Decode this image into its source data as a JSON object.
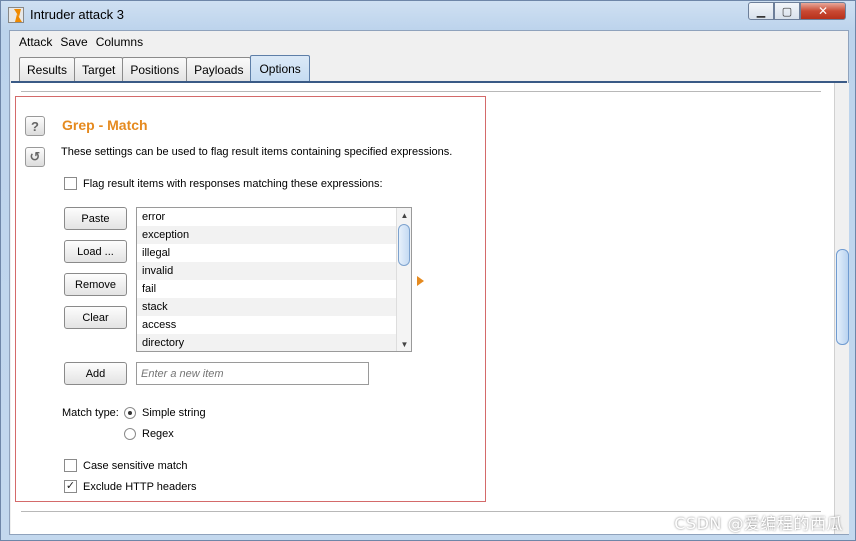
{
  "window": {
    "title": "Intruder attack 3"
  },
  "menu": [
    "Attack",
    "Save",
    "Columns"
  ],
  "tabs": [
    "Results",
    "Target",
    "Positions",
    "Payloads",
    "Options"
  ],
  "active_tab": "Options",
  "section": {
    "title": "Grep - Match",
    "description": "These settings can be used to flag result items containing specified expressions.",
    "flag_label": "Flag result items with responses matching these expressions:",
    "flag_checked": false,
    "buttons": {
      "paste": "Paste",
      "load": "Load ...",
      "remove": "Remove",
      "clear": "Clear",
      "add": "Add"
    },
    "items": [
      "error",
      "exception",
      "illegal",
      "invalid",
      "fail",
      "stack",
      "access",
      "directory"
    ],
    "new_item_placeholder": "Enter a new item",
    "match_type_label": "Match type:",
    "match_types": [
      "Simple string",
      "Regex"
    ],
    "match_type_selected": "Simple string",
    "case_sensitive_label": "Case sensitive match",
    "case_sensitive_checked": false,
    "exclude_headers_label": "Exclude HTTP headers",
    "exclude_headers_checked": true
  },
  "watermark": "CSDN @爱编程的西瓜",
  "icons": [
    "burp-app-icon",
    "help-icon",
    "restore-defaults-icon",
    "minimize-icon",
    "maximize-icon",
    "close-icon"
  ]
}
